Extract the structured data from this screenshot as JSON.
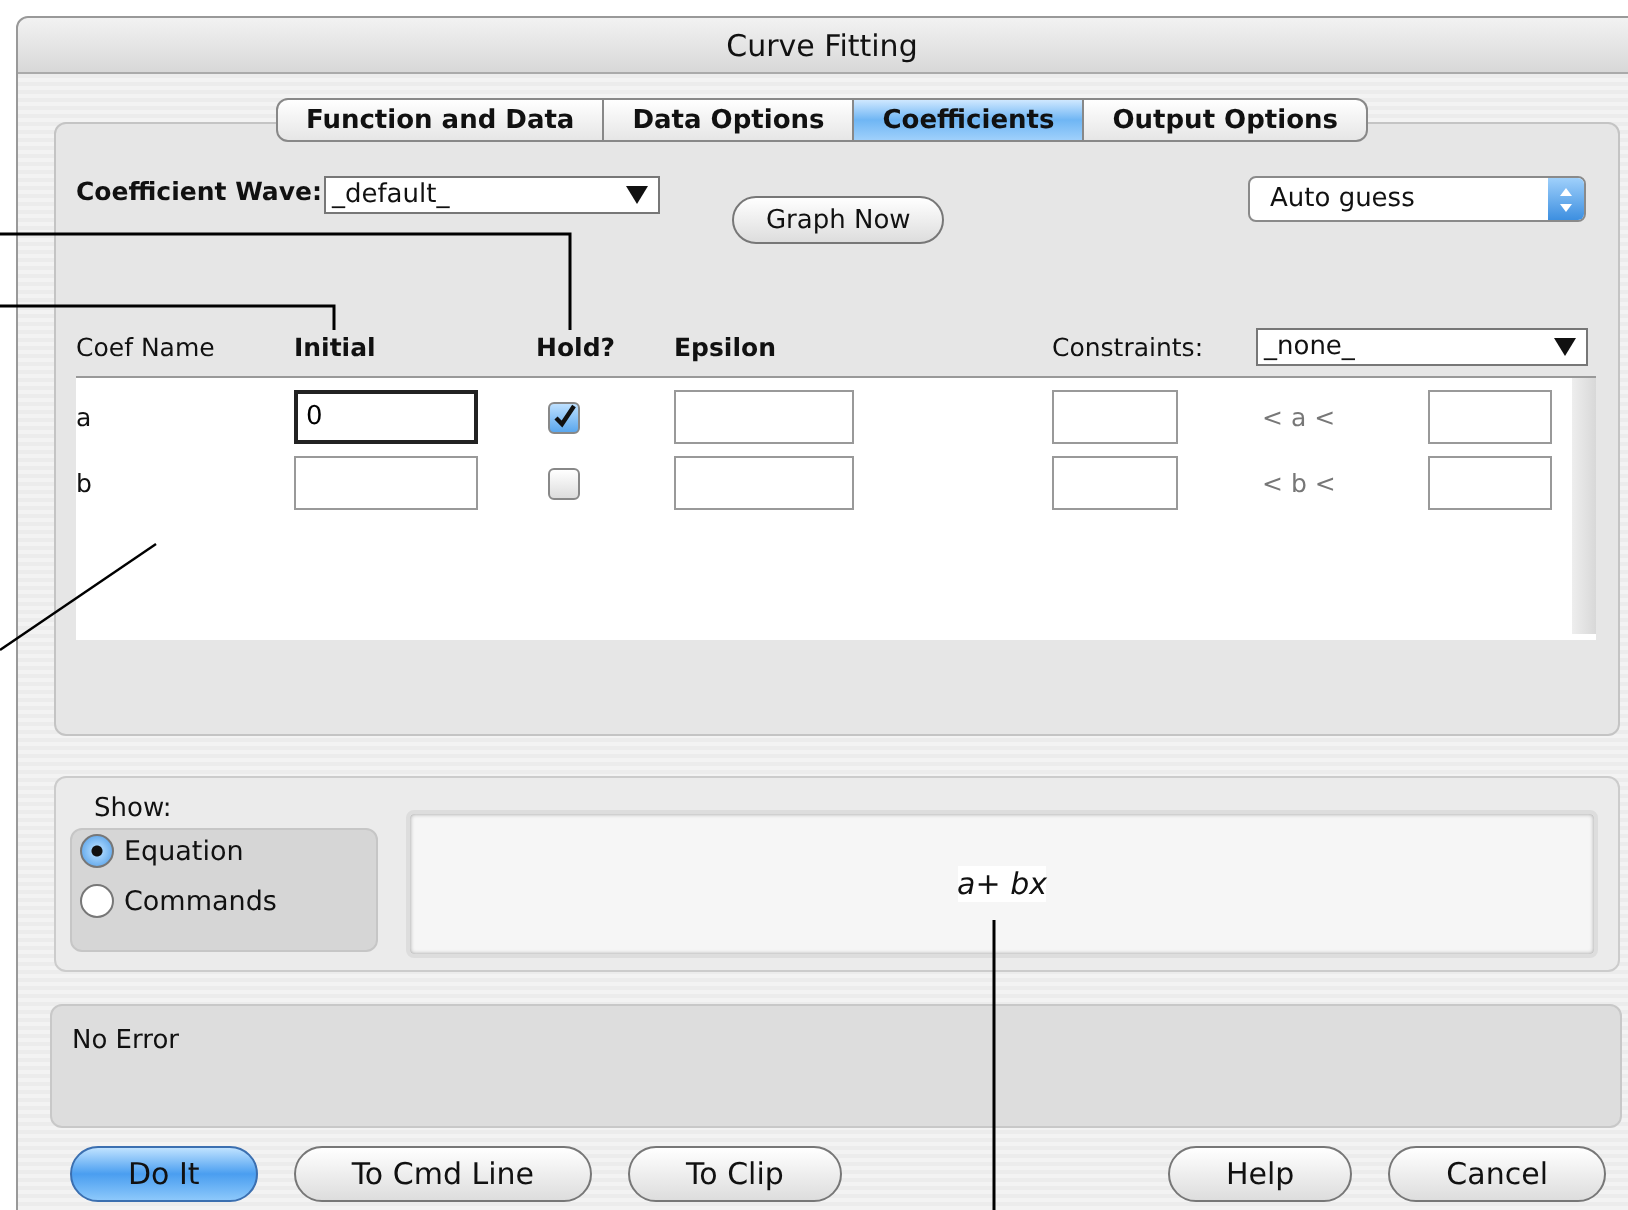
{
  "window": {
    "title": "Curve Fitting"
  },
  "tabs": [
    {
      "label": "Function and Data",
      "selected": false
    },
    {
      "label": "Data Options",
      "selected": false
    },
    {
      "label": "Coefficients",
      "selected": true
    },
    {
      "label": "Output Options",
      "selected": false
    }
  ],
  "coefficient_wave": {
    "label": "Coefficient Wave:",
    "value": "_default_"
  },
  "guess_menu": {
    "value": "Auto guess"
  },
  "graph_button": {
    "label": "Graph Now"
  },
  "columns": [
    "Coef Name",
    "Initial",
    "Hold?",
    "Epsilon",
    "Constraints:"
  ],
  "constraints_menu": {
    "value": "_none_"
  },
  "rows": [
    {
      "name": "a",
      "initial": "0",
      "focused": true,
      "hold": true,
      "constraint_label": "< a <"
    },
    {
      "name": "b",
      "focused": false,
      "hold": false,
      "constraint_label": "< b <"
    }
  ],
  "show": {
    "label": "Show:",
    "options": [
      {
        "label": "Equation",
        "selected": true
      },
      {
        "label": "Commands",
        "selected": false
      }
    ],
    "equation": "*a*+ *bx*"
  },
  "status": "No Error",
  "buttons": [
    {
      "label": "Do It",
      "default": true
    },
    {
      "label": "To Cmd Line",
      "default": false
    },
    {
      "label": "To Clip",
      "default": false
    },
    {
      "label": "Help",
      "default": false
    },
    {
      "label": "Cancel",
      "default": false
    }
  ]
}
